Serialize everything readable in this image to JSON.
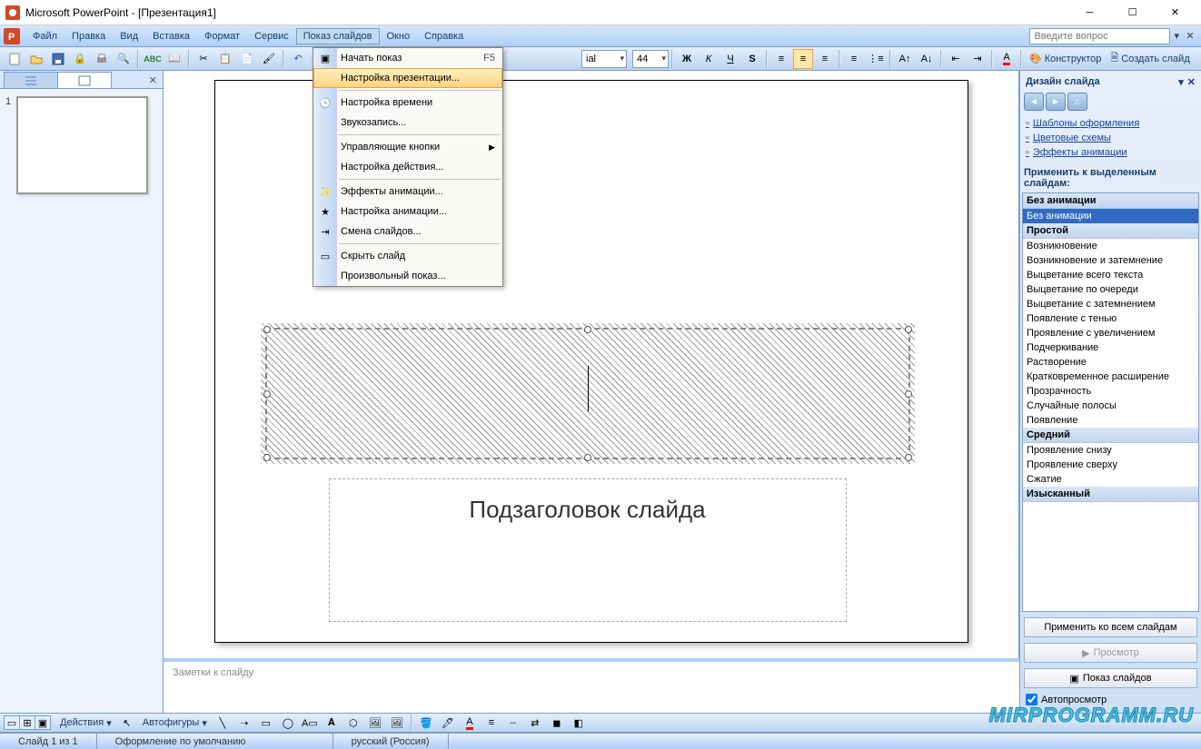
{
  "title": "Microsoft PowerPoint - [Презентация1]",
  "help_placeholder": "Введите вопрос",
  "menubar": {
    "file": "Файл",
    "edit": "Правка",
    "view": "Вид",
    "insert": "Вставка",
    "format": "Формат",
    "tools": "Сервис",
    "slideshow": "Показ слайдов",
    "window": "Окно",
    "help": "Справка"
  },
  "toolbar": {
    "font_name": "ial",
    "font_size": "44",
    "constructor": "Конструктор",
    "create_slide": "Создать слайд"
  },
  "dropdown": {
    "start": "Начать показ",
    "start_key": "F5",
    "setup": "Настройка презентации...",
    "rehearse": "Настройка времени",
    "record": "Звукозапись...",
    "action_buttons": "Управляющие кнопки",
    "action_settings": "Настройка действия...",
    "anim_effects": "Эффекты анимации...",
    "anim_setup": "Настройка анимации...",
    "transition": "Смена слайдов...",
    "hide": "Скрыть слайд",
    "custom": "Произвольный показ..."
  },
  "slide": {
    "thumb_num": "1",
    "subtitle": "Подзаголовок слайда",
    "notes": "Заметки к слайду"
  },
  "drawbar": {
    "actions": "Действия",
    "autoshapes": "Автофигуры"
  },
  "status": {
    "slide": "Слайд 1 из 1",
    "design": "Оформление по умолчанию",
    "lang": "русский (Россия)"
  },
  "taskpane": {
    "title": "Дизайн слайда",
    "link_templates": "Шаблоны оформления",
    "link_colors": "Цветовые схемы",
    "link_effects": "Эффекты анимации",
    "apply_label": "Применить к выделенным слайдам:",
    "groups": {
      "g1": "Без анимации",
      "g2": "Простой",
      "g3": "Средний",
      "g4": "Изысканный"
    },
    "items": {
      "none": "Без анимации",
      "appear": "Возникновение",
      "appear_dim": "Возникновение и затемнение",
      "fade_all": "Выцветание всего текста",
      "fade_one": "Выцветание по очереди",
      "fade_dim": "Выцветание с затемнением",
      "shadow": "Появление с тенью",
      "zoom": "Проявление с увеличением",
      "underline": "Подчеркивание",
      "dissolve": "Растворение",
      "expand": "Кратковременное расширение",
      "transparency": "Прозрачность",
      "random_bars": "Случайные полосы",
      "appear2": "Появление",
      "from_bottom": "Проявление снизу",
      "from_top": "Проявление сверху",
      "compress": "Сжатие"
    },
    "apply_all": "Применить ко всем слайдам",
    "preview": "Просмотр",
    "slideshow_btn": "Показ слайдов",
    "autopreview": "Автопросмотр"
  },
  "watermark": "MIRPROGRAMM.RU"
}
